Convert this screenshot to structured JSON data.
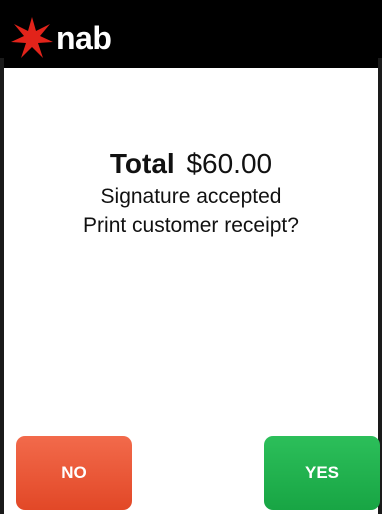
{
  "header": {
    "brand": "nab",
    "logo_icon": "nab-star-icon",
    "brand_color": "#e2231a",
    "background": "#000000"
  },
  "transaction": {
    "total_label": "Total",
    "total_amount": "$60.00",
    "status_text": "Signature accepted",
    "prompt_text": "Print customer receipt?"
  },
  "actions": {
    "no_label": "NO",
    "no_color": "#e84a2a",
    "yes_label": "YES",
    "yes_color": "#1fae4c"
  }
}
